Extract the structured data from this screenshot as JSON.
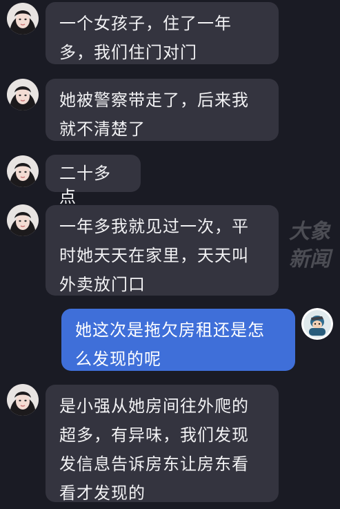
{
  "conversation": {
    "messages": [
      {
        "side": "received",
        "text": "一个女孩子，住了一年多，我们住门对门"
      },
      {
        "side": "received",
        "text": "她被警察带走了，后来我就不清楚了"
      },
      {
        "side": "received",
        "text": "二十多点"
      },
      {
        "side": "received",
        "text": "一年多我就见过一次，平时她天天在家里，天天叫外卖放门口"
      },
      {
        "side": "sent",
        "text": "她这次是拖欠房租还是怎么发现的呢"
      },
      {
        "side": "received",
        "text": "是小强从她房间往外爬的超多，有异味，我们发现发信息告诉房东让房东看看才发现的"
      }
    ]
  },
  "watermark": {
    "line1": "大象",
    "line2": "新闻"
  },
  "colors": {
    "background": "#1a1b24",
    "received_bubble": "#34343f",
    "sent_bubble": "#3f6fd9"
  },
  "icons": {
    "received_avatar": "woman-portrait-avatar",
    "sent_avatar": "cartoon-character-avatar"
  }
}
